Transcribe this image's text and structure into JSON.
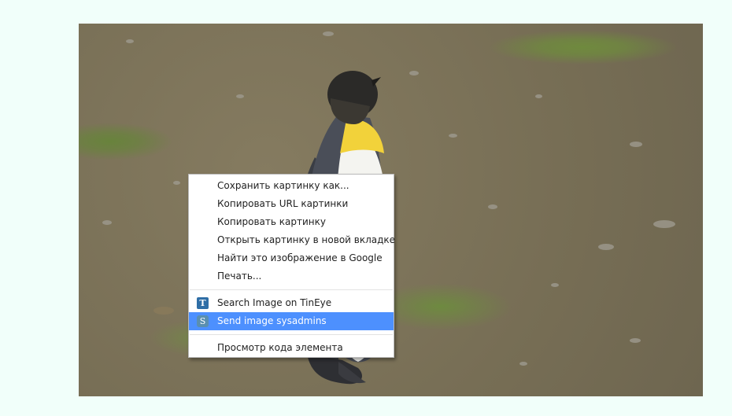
{
  "image": {
    "subject": "penguin-photo"
  },
  "context_menu": {
    "items": [
      {
        "label": "Сохранить картинку как...",
        "icon": null
      },
      {
        "label": "Копировать URL картинки",
        "icon": null
      },
      {
        "label": "Копировать картинку",
        "icon": null
      },
      {
        "label": "Открыть картинку в новой вкладке",
        "icon": null
      },
      {
        "label": "Найти это изображение в Google",
        "icon": null
      },
      {
        "label": "Печать...",
        "icon": null
      }
    ],
    "extension_items": [
      {
        "label": "Search Image on TinEye",
        "icon": "tineye-icon",
        "glyph": "T"
      },
      {
        "label": "Send image sysadmins",
        "icon": "sysadmins-icon",
        "glyph": "S",
        "highlighted": true
      }
    ],
    "inspect_item": {
      "label": "Просмотр кода элемента"
    },
    "highlight_color": "#4d90fe"
  }
}
